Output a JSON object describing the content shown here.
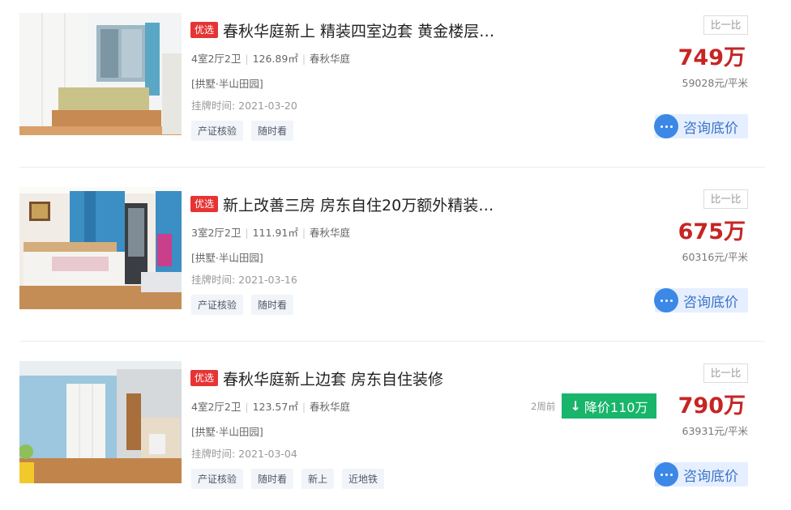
{
  "common": {
    "compare_label": "比一比",
    "consult_label": "咨询底价",
    "colors": {
      "price": "#c62524",
      "badge": "#e63434",
      "consult": "#3c88e6",
      "drop": "#18b56a"
    }
  },
  "listings": [
    {
      "badge": "优选",
      "title": "春秋华庭新上 精装四室边套 黄金楼层…",
      "layout": "4室2厅2卫",
      "area": "126.89㎡",
      "estate": "春秋华庭",
      "community": "[拱墅·半山田园]",
      "listed": "挂牌时间: 2021-03-20",
      "tags": [
        "产证核验",
        "随时看"
      ],
      "price": "749万",
      "unit_price": "59028元/平米"
    },
    {
      "badge": "优选",
      "title": "新上改善三房 房东自住20万额外精装…",
      "layout": "3室2厅2卫",
      "area": "111.91㎡",
      "estate": "春秋华庭",
      "community": "[拱墅·半山田园]",
      "listed": "挂牌时间: 2021-03-16",
      "tags": [
        "产证核验",
        "随时看"
      ],
      "price": "675万",
      "unit_price": "60316元/平米"
    },
    {
      "badge": "优选",
      "title": "春秋华庭新上边套 房东自住装修",
      "layout": "4室2厅2卫",
      "area": "123.57㎡",
      "estate": "春秋华庭",
      "community": "[拱墅·半山田园]",
      "listed": "挂牌时间: 2021-03-04",
      "tags": [
        "产证核验",
        "随时看",
        "新上",
        "近地铁"
      ],
      "price": "790万",
      "unit_price": "63931元/平米",
      "price_drop": {
        "time": "2周前",
        "label": "降价110万",
        "icon": "down-arrow-icon"
      }
    }
  ]
}
